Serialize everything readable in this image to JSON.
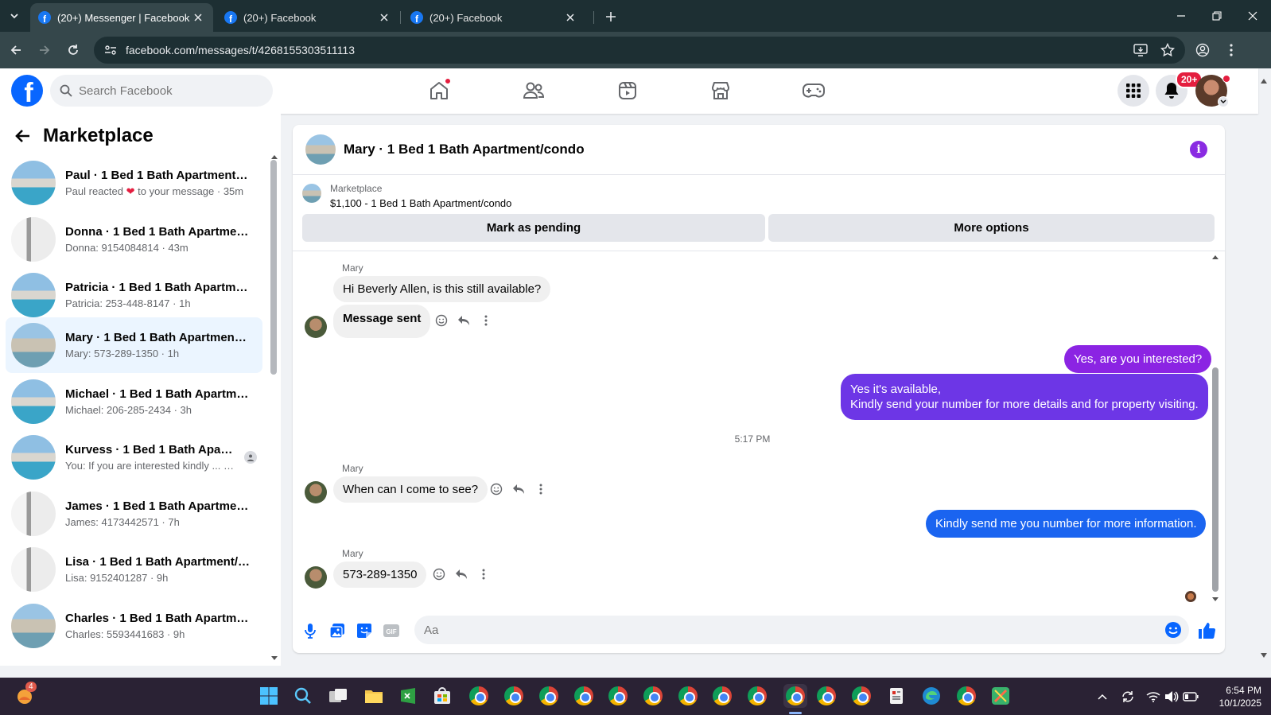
{
  "browser": {
    "tabs": [
      {
        "title": "(20+) Messenger | Facebook",
        "active": true
      },
      {
        "title": "(20+) Facebook",
        "active": false
      },
      {
        "title": "(20+) Facebook",
        "active": false
      }
    ],
    "url": "facebook.com/messages/t/4268155303511113"
  },
  "header": {
    "search_placeholder": "Search Facebook",
    "notification_badge": "20+"
  },
  "sidebar": {
    "title": "Marketplace",
    "conversations": [
      {
        "name": "Paul · 1 Bed 1 Bath Apartment/c...",
        "sub_prefix": "Paul reacted",
        "sub_suffix": "to your message · 35m",
        "thumb": "pool"
      },
      {
        "name": "Donna · 1 Bed 1 Bath Apartment...",
        "sub": "Donna: 9154084814 · 43m",
        "thumb": "interior"
      },
      {
        "name": "Patricia · 1 Bed 1 Bath Apartmen...",
        "sub": "Patricia: 253-448-8147 · 1h",
        "thumb": "pool"
      },
      {
        "name": "Mary · 1 Bed 1 Bath Apartment/c...",
        "sub": "Mary: 573-289-1350 · 1h",
        "thumb": "building"
      },
      {
        "name": "Michael · 1 Bed 1 Bath Apartmen...",
        "sub": "Michael: 206-285-2434 · 3h",
        "thumb": "pool"
      },
      {
        "name": "Kurvess · 1 Bed 1 Bath Apartm...",
        "sub": "You: If you are interested kindly ... · 6h",
        "thumb": "pool"
      },
      {
        "name": "James · 1 Bed 1 Bath Apartment/...",
        "sub": "James: 4173442571 · 7h",
        "thumb": "interior"
      },
      {
        "name": "Lisa · 1 Bed 1 Bath Apartment/co...",
        "sub": "Lisa: 9152401287 · 9h",
        "thumb": "interior"
      },
      {
        "name": "Charles · 1 Bed 1 Bath Apartmen...",
        "sub": "Charles: 5593441683 · 9h",
        "thumb": "building"
      }
    ]
  },
  "chat": {
    "title": "Mary · 1 Bed 1 Bath Apartment/condo",
    "marketplace_label": "Marketplace",
    "listing": "$1,100 - 1 Bed 1 Bath Apartment/condo",
    "mark_pending": "Mark as pending",
    "more_options": "More options",
    "messages": {
      "m1_sender": "Mary",
      "m1": "Hi Beverly Allen, is this still available?",
      "m2": "Message sent",
      "o1": "Yes, are you interested?",
      "o2_line1": "Yes it's available,",
      "o2_line2": "Kindly send your number for more details and for property visiting.",
      "timestamp": "5:17 PM",
      "m3_sender": "Mary",
      "m3": "When can I come to see?",
      "o3": "Kindly send me you number for more information.",
      "m4_sender": "Mary",
      "m4": "573-289-1350"
    },
    "composer_placeholder": "Aa",
    "colors": {
      "out_purple": "#8b24e3",
      "out_blue": "#1a64f0"
    }
  },
  "taskbar": {
    "notification_count": "4",
    "time": "6:54 PM",
    "date": "10/1/2025"
  }
}
